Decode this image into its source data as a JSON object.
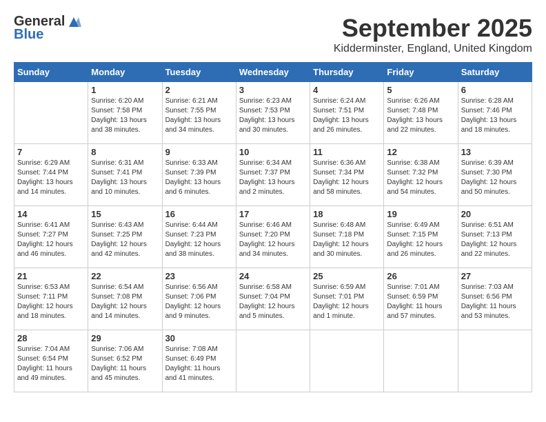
{
  "logo": {
    "general": "General",
    "blue": "Blue"
  },
  "header": {
    "month": "September 2025",
    "location": "Kidderminster, England, United Kingdom"
  },
  "weekdays": [
    "Sunday",
    "Monday",
    "Tuesday",
    "Wednesday",
    "Thursday",
    "Friday",
    "Saturday"
  ],
  "weeks": [
    [
      {
        "day": null
      },
      {
        "day": 1,
        "sunrise": "6:20 AM",
        "sunset": "7:58 PM",
        "daylight": "13 hours and 38 minutes."
      },
      {
        "day": 2,
        "sunrise": "6:21 AM",
        "sunset": "7:55 PM",
        "daylight": "13 hours and 34 minutes."
      },
      {
        "day": 3,
        "sunrise": "6:23 AM",
        "sunset": "7:53 PM",
        "daylight": "13 hours and 30 minutes."
      },
      {
        "day": 4,
        "sunrise": "6:24 AM",
        "sunset": "7:51 PM",
        "daylight": "13 hours and 26 minutes."
      },
      {
        "day": 5,
        "sunrise": "6:26 AM",
        "sunset": "7:48 PM",
        "daylight": "13 hours and 22 minutes."
      },
      {
        "day": 6,
        "sunrise": "6:28 AM",
        "sunset": "7:46 PM",
        "daylight": "13 hours and 18 minutes."
      }
    ],
    [
      {
        "day": 7,
        "sunrise": "6:29 AM",
        "sunset": "7:44 PM",
        "daylight": "13 hours and 14 minutes."
      },
      {
        "day": 8,
        "sunrise": "6:31 AM",
        "sunset": "7:41 PM",
        "daylight": "13 hours and 10 minutes."
      },
      {
        "day": 9,
        "sunrise": "6:33 AM",
        "sunset": "7:39 PM",
        "daylight": "13 hours and 6 minutes."
      },
      {
        "day": 10,
        "sunrise": "6:34 AM",
        "sunset": "7:37 PM",
        "daylight": "13 hours and 2 minutes."
      },
      {
        "day": 11,
        "sunrise": "6:36 AM",
        "sunset": "7:34 PM",
        "daylight": "12 hours and 58 minutes."
      },
      {
        "day": 12,
        "sunrise": "6:38 AM",
        "sunset": "7:32 PM",
        "daylight": "12 hours and 54 minutes."
      },
      {
        "day": 13,
        "sunrise": "6:39 AM",
        "sunset": "7:30 PM",
        "daylight": "12 hours and 50 minutes."
      }
    ],
    [
      {
        "day": 14,
        "sunrise": "6:41 AM",
        "sunset": "7:27 PM",
        "daylight": "12 hours and 46 minutes."
      },
      {
        "day": 15,
        "sunrise": "6:43 AM",
        "sunset": "7:25 PM",
        "daylight": "12 hours and 42 minutes."
      },
      {
        "day": 16,
        "sunrise": "6:44 AM",
        "sunset": "7:23 PM",
        "daylight": "12 hours and 38 minutes."
      },
      {
        "day": 17,
        "sunrise": "6:46 AM",
        "sunset": "7:20 PM",
        "daylight": "12 hours and 34 minutes."
      },
      {
        "day": 18,
        "sunrise": "6:48 AM",
        "sunset": "7:18 PM",
        "daylight": "12 hours and 30 minutes."
      },
      {
        "day": 19,
        "sunrise": "6:49 AM",
        "sunset": "7:15 PM",
        "daylight": "12 hours and 26 minutes."
      },
      {
        "day": 20,
        "sunrise": "6:51 AM",
        "sunset": "7:13 PM",
        "daylight": "12 hours and 22 minutes."
      }
    ],
    [
      {
        "day": 21,
        "sunrise": "6:53 AM",
        "sunset": "7:11 PM",
        "daylight": "12 hours and 18 minutes."
      },
      {
        "day": 22,
        "sunrise": "6:54 AM",
        "sunset": "7:08 PM",
        "daylight": "12 hours and 14 minutes."
      },
      {
        "day": 23,
        "sunrise": "6:56 AM",
        "sunset": "7:06 PM",
        "daylight": "12 hours and 9 minutes."
      },
      {
        "day": 24,
        "sunrise": "6:58 AM",
        "sunset": "7:04 PM",
        "daylight": "12 hours and 5 minutes."
      },
      {
        "day": 25,
        "sunrise": "6:59 AM",
        "sunset": "7:01 PM",
        "daylight": "12 hours and 1 minute."
      },
      {
        "day": 26,
        "sunrise": "7:01 AM",
        "sunset": "6:59 PM",
        "daylight": "11 hours and 57 minutes."
      },
      {
        "day": 27,
        "sunrise": "7:03 AM",
        "sunset": "6:56 PM",
        "daylight": "11 hours and 53 minutes."
      }
    ],
    [
      {
        "day": 28,
        "sunrise": "7:04 AM",
        "sunset": "6:54 PM",
        "daylight": "11 hours and 49 minutes."
      },
      {
        "day": 29,
        "sunrise": "7:06 AM",
        "sunset": "6:52 PM",
        "daylight": "11 hours and 45 minutes."
      },
      {
        "day": 30,
        "sunrise": "7:08 AM",
        "sunset": "6:49 PM",
        "daylight": "11 hours and 41 minutes."
      },
      {
        "day": null
      },
      {
        "day": null
      },
      {
        "day": null
      },
      {
        "day": null
      }
    ]
  ],
  "labels": {
    "sunrise": "Sunrise:",
    "sunset": "Sunset:",
    "daylight": "Daylight:"
  }
}
